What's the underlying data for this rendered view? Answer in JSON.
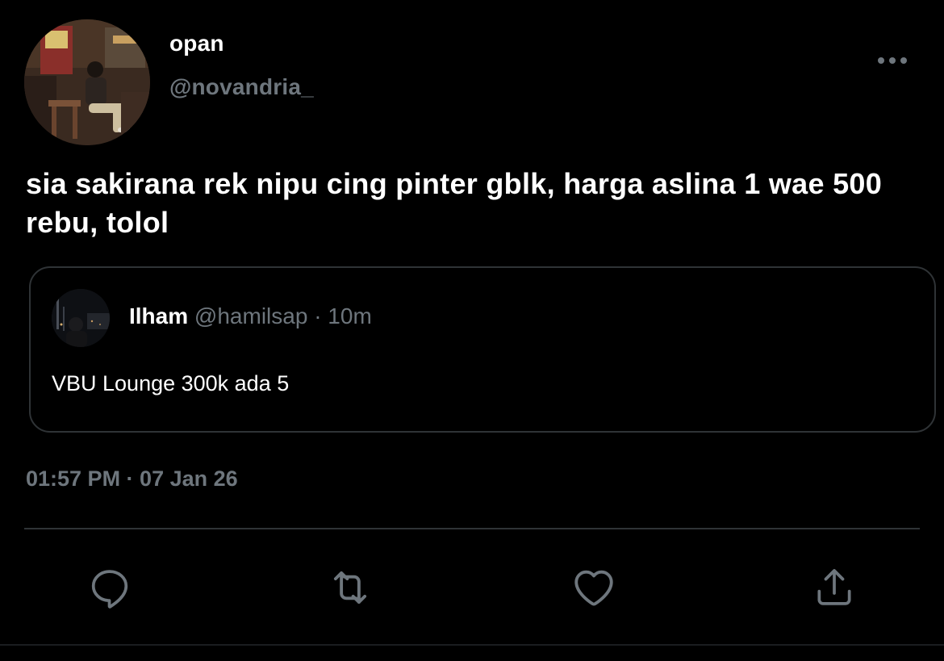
{
  "author": {
    "display_name": "opan",
    "handle": "@novandria_",
    "avatar_icon": "profile-photo"
  },
  "tweet": {
    "text": "sia sakirana rek nipu cing pinter gblk, harga aslina 1 wae 500 rebu, tolol",
    "timestamp": "01:57 PM · 07 Jan 26"
  },
  "quoted_tweet": {
    "display_name": "Ilham",
    "handle": "@hamilsap",
    "separator": "·",
    "time": "10m",
    "text": "VBU Lounge 300k ada 5",
    "avatar_icon": "profile-photo"
  },
  "icons": {
    "more": "more-horizontal-icon",
    "reply": "reply-icon",
    "retweet": "retweet-icon",
    "like": "heart-icon",
    "share": "share-icon"
  },
  "colors": {
    "background": "#000000",
    "primary_text": "#ffffff",
    "secondary_text": "#6e767d",
    "border": "#2f3336"
  }
}
